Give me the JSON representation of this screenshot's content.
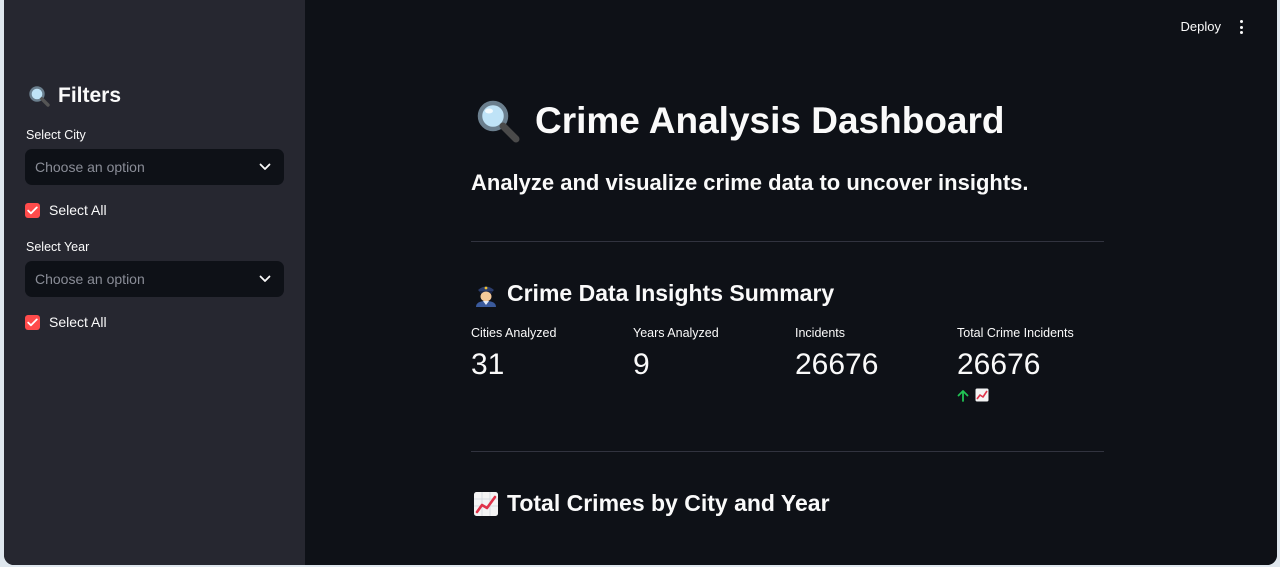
{
  "topbar": {
    "deploy_label": "Deploy"
  },
  "sidebar": {
    "header": "Filters",
    "city_filter": {
      "label": "Select City",
      "placeholder": "Choose an option",
      "select_all_label": "Select All",
      "select_all_checked": true
    },
    "year_filter": {
      "label": "Select Year",
      "placeholder": "Choose an option",
      "select_all_label": "Select All",
      "select_all_checked": true
    }
  },
  "main": {
    "title": "Crime Analysis Dashboard",
    "subtitle": "Analyze and visualize crime data to uncover insights.",
    "summary_title": "Crime Data Insights Summary",
    "metrics": [
      {
        "label": "Cities Analyzed",
        "value": "31"
      },
      {
        "label": "Years Analyzed",
        "value": "9"
      },
      {
        "label": "Incidents",
        "value": "26676"
      },
      {
        "label": "Total Crime Incidents",
        "value": "26676"
      }
    ],
    "chart_section_title": "Total Crimes by City and Year"
  },
  "colors": {
    "accent": "#ff4b4b",
    "sidebar_bg": "#262730",
    "main_bg": "#0e1117",
    "delta_up": "#21c354"
  },
  "icons": {
    "filters": "magnifying-glass-icon",
    "title": "magnifying-glass-icon",
    "summary": "police-officer-icon",
    "delta": "arrow-up-icon",
    "delta_chart": "chart-increasing-icon",
    "chart_section": "chart-increasing-icon"
  }
}
